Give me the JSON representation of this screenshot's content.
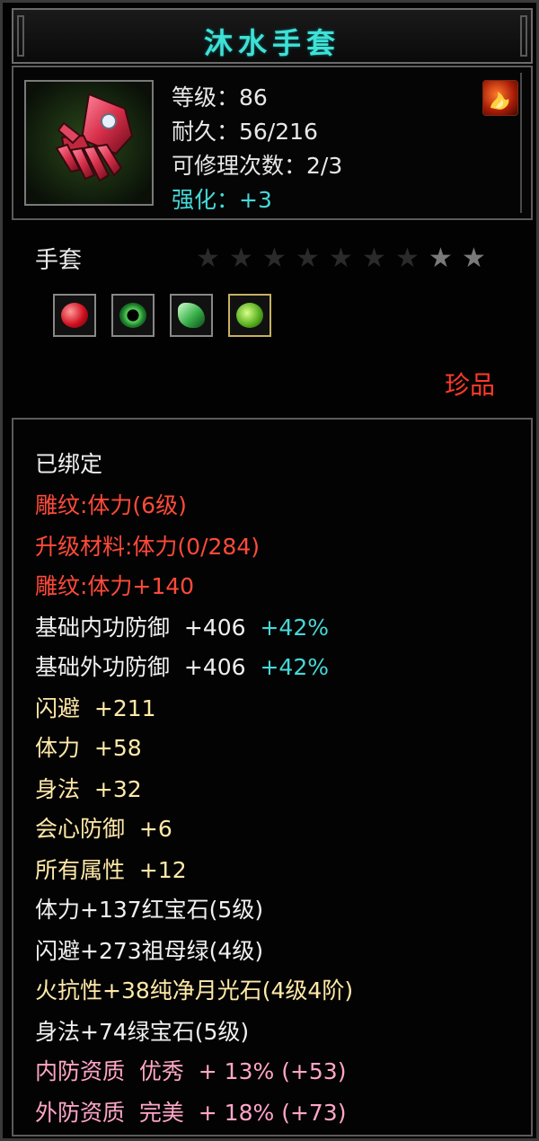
{
  "item": {
    "name": "沐水手套",
    "level": "等级：86",
    "durability": "耐久：56/216",
    "repairs": "可修理次数：2/3",
    "enhance": "强化：+3",
    "type": "手套",
    "rarity": "珍品",
    "stars_total": 9,
    "stars_lit": 2
  },
  "icons": {
    "item_icon": "glove-icon",
    "badge": "fire-icon",
    "gems": [
      "red-gem-icon",
      "green-ring-gem-icon",
      "green-crystal-gem-icon",
      "green-gem-icon"
    ]
  },
  "attributes": {
    "bound": "已绑定",
    "engrave_level": "雕纹:体力(6级)",
    "upgrade_material": "升级材料:体力(0/284)",
    "engrave_bonus": "雕纹:体力+140",
    "base_inner_def": "基础内功防御  +406",
    "base_inner_def_pct": "+42%",
    "base_outer_def": "基础外功防御  +406",
    "base_outer_def_pct": "+42%",
    "dodge": "闪避  +211",
    "stamina": "体力  +58",
    "agility": "身法  +32",
    "crit_def": "会心防御  +6",
    "all_attr": "所有属性  +12",
    "gem1": "体力+137红宝石(5级)",
    "gem2": "闪避+273祖母绿(4级)",
    "gem3": "火抗性+38纯净月光石(4级4阶)",
    "gem4": "身法+74绿宝石(5级)",
    "inner_quality": "内防资质  优秀  + 13% (+53)",
    "outer_quality": "外防资质  完美  + 18% (+73)"
  },
  "colors": {
    "title": "#3fe0d6",
    "cyan": "#46d8d8",
    "red": "#ff4a3a",
    "yellow": "#ffe9a8",
    "pink": "#ffa6c6",
    "rarity": "#ff3a2a"
  }
}
